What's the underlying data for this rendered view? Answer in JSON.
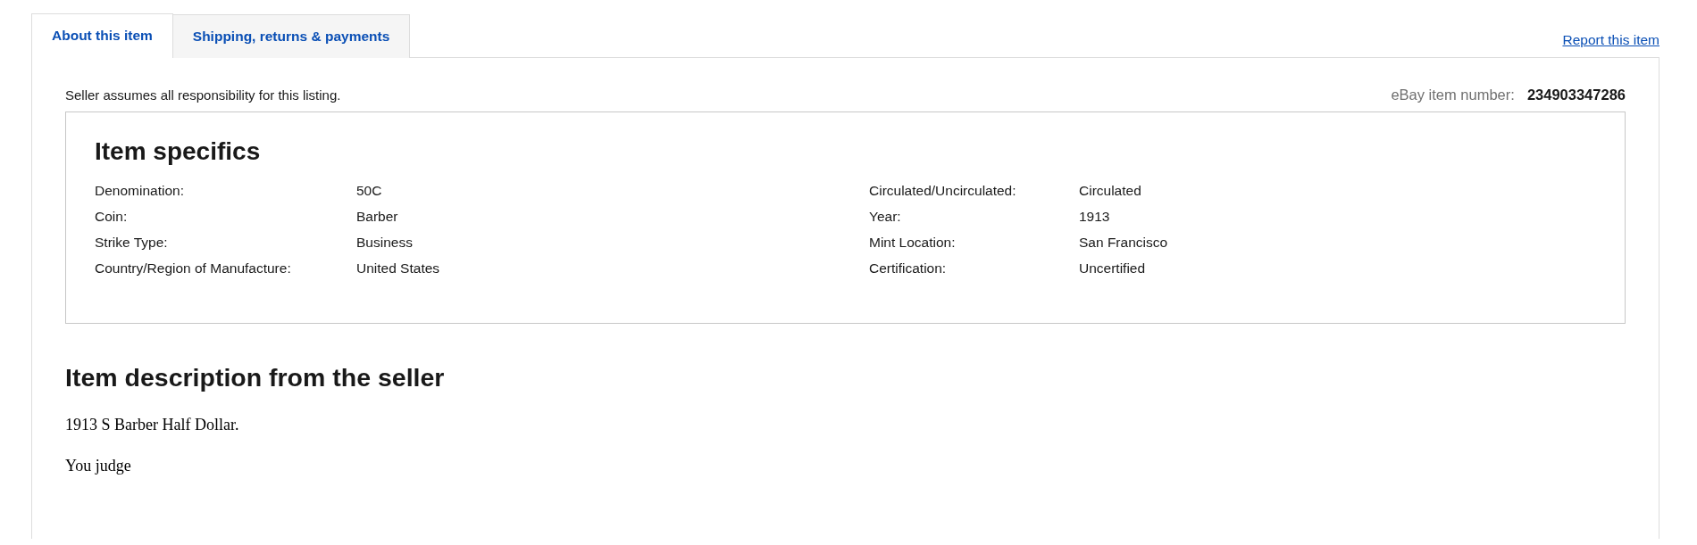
{
  "tabs": [
    {
      "label": "About this item",
      "selected": true
    },
    {
      "label": "Shipping, returns & payments",
      "selected": false
    }
  ],
  "report_link": "Report this item",
  "responsibility_note": "Seller assumes all responsibility for this listing.",
  "item_number": {
    "label": "eBay item number:",
    "value": "234903347286"
  },
  "item_specifics": {
    "title": "Item specifics",
    "rows": [
      {
        "left_label": "Denomination:",
        "left_value": "50C",
        "right_label": "Circulated/Uncirculated:",
        "right_value": "Circulated"
      },
      {
        "left_label": "Coin:",
        "left_value": "Barber",
        "right_label": "Year:",
        "right_value": "1913"
      },
      {
        "left_label": "Strike Type:",
        "left_value": "Business",
        "right_label": "Mint Location:",
        "right_value": "San Francisco"
      },
      {
        "left_label": "Country/Region of Manufacture:",
        "left_value": "United States",
        "right_label": "Certification:",
        "right_value": "Uncertified"
      }
    ]
  },
  "description": {
    "title": "Item description from the seller",
    "paragraphs": [
      "1913 S Barber Half Dollar.",
      "You judge"
    ]
  }
}
